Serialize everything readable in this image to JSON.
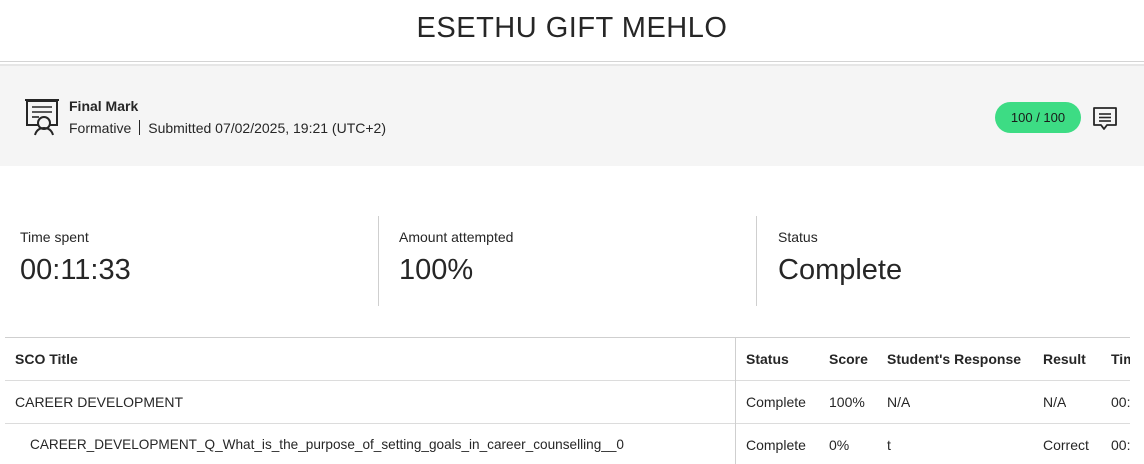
{
  "header": {
    "title": "ESETHU GIFT MEHLO"
  },
  "grade": {
    "title": "Final Mark",
    "type": "Formative",
    "submitted": "Submitted 07/02/2025, 19:21 (UTC+2)",
    "score": "100 / 100",
    "score_color": "#3ddc84",
    "icon": "certificate-icon",
    "feedback_icon": "feedback-icon"
  },
  "stats": [
    {
      "label": "Time spent",
      "value": "00:11:33"
    },
    {
      "label": "Amount attempted",
      "value": "100%"
    },
    {
      "label": "Status",
      "value": "Complete"
    }
  ],
  "table": {
    "headers": [
      "SCO Title",
      "Status",
      "Score",
      "Student's Response",
      "Result",
      "Tim"
    ],
    "rows": [
      [
        "CAREER DEVELOPMENT",
        "Complete",
        "100%",
        "N/A",
        "N/A",
        "00:"
      ],
      [
        "CAREER_DEVELOPMENT_Q_What_is_the_purpose_of_setting_goals_in_career_counselling__0",
        "Complete",
        "0%",
        "t",
        "Correct",
        "00:"
      ]
    ]
  }
}
